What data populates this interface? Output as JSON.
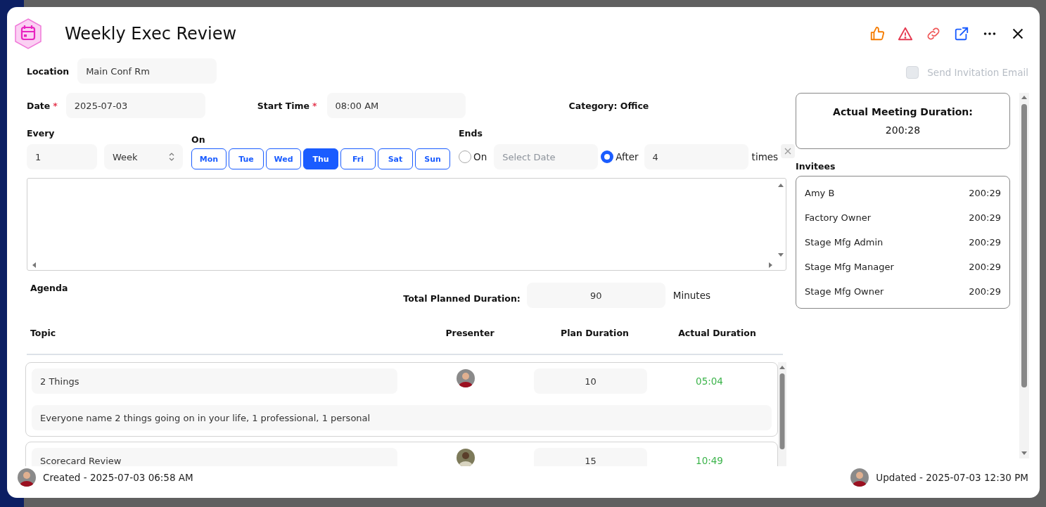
{
  "title": "Weekly Exec Review",
  "location": {
    "label": "Location",
    "value": "Main Conf Rm"
  },
  "send_invitation": {
    "label": "Send Invitation Email",
    "checked": false,
    "disabled": true
  },
  "date": {
    "label": "Date",
    "required_mark": "*",
    "value": "2025-07-03"
  },
  "start_time": {
    "label": "Start Time",
    "required_mark": "*",
    "value": "08:00 AM"
  },
  "category": "Category: Office",
  "recurrence": {
    "every_label": "Every",
    "interval": "1",
    "unit": "Week",
    "on_label": "On",
    "days": [
      {
        "label": "Mon",
        "selected": false
      },
      {
        "label": "Tue",
        "selected": false
      },
      {
        "label": "Wed",
        "selected": false
      },
      {
        "label": "Thu",
        "selected": true
      },
      {
        "label": "Fri",
        "selected": false
      },
      {
        "label": "Sat",
        "selected": false
      },
      {
        "label": "Sun",
        "selected": false
      }
    ],
    "ends_label": "Ends",
    "ends_options": [
      {
        "kind": "date",
        "label": "On",
        "selected": false,
        "placeholder": "Select Date"
      },
      {
        "kind": "count",
        "label": "After",
        "selected": true,
        "value": "4",
        "suffix": "times"
      }
    ]
  },
  "agenda": {
    "label": "Agenda",
    "total_label": "Total Planned Duration:",
    "total_value": "90",
    "total_unit": "Minutes",
    "columns": [
      "Topic",
      "Presenter",
      "Plan Duration",
      "Actual Duration"
    ],
    "items": [
      {
        "topic": "2 Things",
        "plan": "10",
        "actual": "05:04",
        "description": "Everyone name 2 things going on in your life, 1 professional, 1 personal"
      },
      {
        "topic": "Scorecard Review",
        "plan": "15",
        "actual": "10:49"
      }
    ]
  },
  "actual_duration": {
    "label": "Actual Meeting Duration:",
    "value": "200:28"
  },
  "invitees": {
    "label": "Invitees",
    "items": [
      {
        "name": "Amy B",
        "time": "200:29"
      },
      {
        "name": "Factory Owner",
        "time": "200:29"
      },
      {
        "name": "Stage Mfg Admin",
        "time": "200:29"
      },
      {
        "name": "Stage Mfg Manager",
        "time": "200:29"
      },
      {
        "name": "Stage Mfg Owner",
        "time": "200:29"
      }
    ]
  },
  "footer": {
    "created": "Created - 2025-07-03 06:58 AM",
    "updated": "Updated - 2025-07-03 12:30 PM"
  }
}
